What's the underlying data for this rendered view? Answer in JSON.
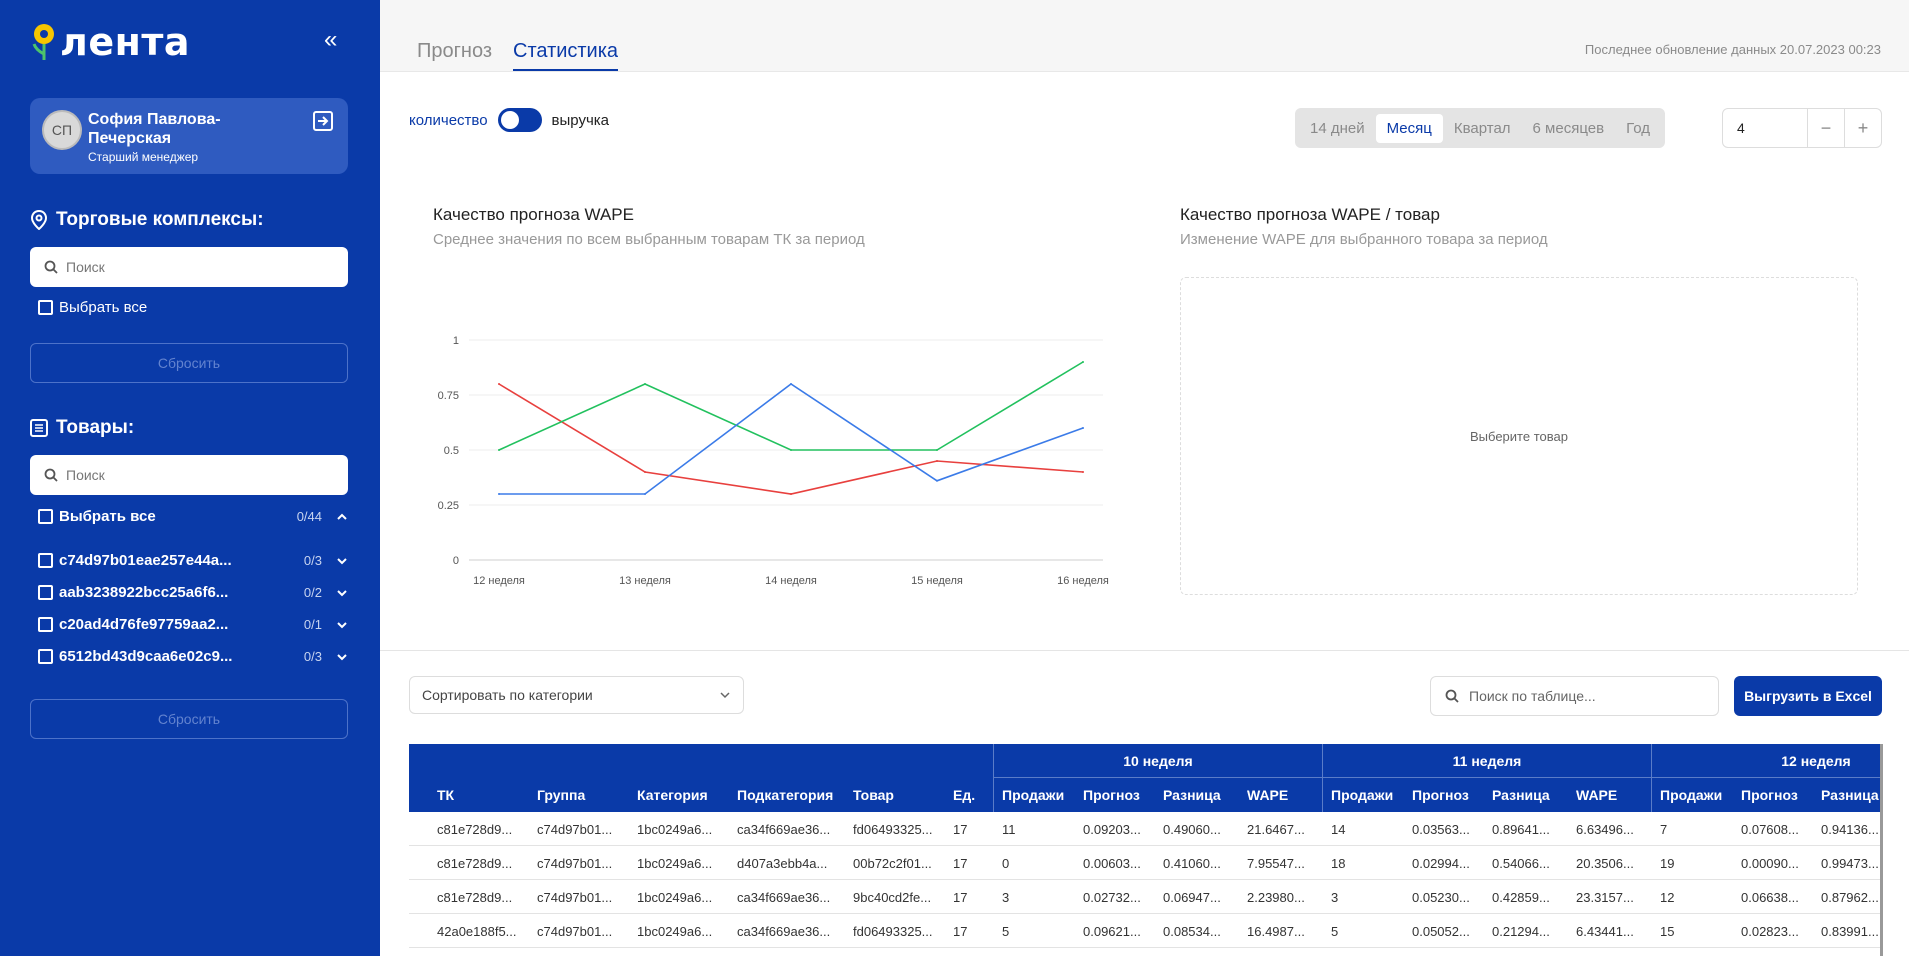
{
  "brand": {
    "logo_text": "лента",
    "primary_color": "#0a3aa8"
  },
  "user": {
    "initials": "СП",
    "name": "София Павлова-Печерская",
    "role": "Старший менеджер"
  },
  "sidebar": {
    "stores_title": "Торговые комплексы:",
    "stores_search_placeholder": "Поиск",
    "stores_select_all": "Выбрать все",
    "stores_reset": "Сбросить",
    "products_title": "Товары:",
    "products_search_placeholder": "Поиск",
    "products_select_all": "Выбрать все",
    "products_select_all_count": "0/44",
    "product_groups": [
      {
        "label": "c74d97b01eae257e44a...",
        "count": "0/3"
      },
      {
        "label": "aab3238922bcc25a6f6...",
        "count": "0/2"
      },
      {
        "label": "c20ad4d76fe97759aa2...",
        "count": "0/1"
      },
      {
        "label": "6512bd43d9caa6e02c9...",
        "count": "0/3"
      }
    ],
    "products_reset": "Сбросить"
  },
  "tabs": {
    "forecast": "Прогноз",
    "stats": "Статистика",
    "active": "Статистика"
  },
  "last_update": "Последнее обновление данных 20.07.2023 00:23",
  "toggle": {
    "left_label": "количество",
    "right_label": "выручка"
  },
  "periods": [
    "14 дней",
    "Месяц",
    "Квартал",
    "6 месяцев",
    "Год"
  ],
  "active_period": "Месяц",
  "stepper": {
    "value": "4",
    "minus": "−",
    "plus": "+"
  },
  "chart1": {
    "title": "Качество прогноза WAPE",
    "subtitle": "Среднее значения по всем выбранным товарам ТК за период"
  },
  "chart2": {
    "title": "Качество прогноза WAPE / товар",
    "subtitle": "Изменение WAPE для выбранного товара за период",
    "placeholder": "Выберите товар"
  },
  "chart_data": {
    "type": "line",
    "categories": [
      "12 неделя",
      "13 неделя",
      "14 неделя",
      "15 неделя",
      "16 неделя"
    ],
    "ylim": [
      0,
      1
    ],
    "yticks": [
      "0",
      "0.25",
      "0.5",
      "0.75",
      "1"
    ],
    "grid": true,
    "series": [
      {
        "color": "#e8403e",
        "values": [
          0.8,
          0.4,
          0.3,
          0.45,
          0.4
        ]
      },
      {
        "color": "#22c15e",
        "values": [
          0.5,
          0.8,
          0.5,
          0.5,
          0.9
        ]
      },
      {
        "color": "#3b7be8",
        "values": [
          0.3,
          0.3,
          0.8,
          0.36,
          0.6
        ]
      }
    ]
  },
  "table_controls": {
    "sort_label": "Сортировать по категории",
    "search_placeholder": "Поиск по таблице...",
    "export_label": "Выгрузить в Excel"
  },
  "table": {
    "fixed_columns": [
      "ТК",
      "Группа",
      "Категория",
      "Подкатегория",
      "Товар",
      "Ед."
    ],
    "weeks": [
      "10 неделя",
      "11 неделя",
      "12 неделя"
    ],
    "week_columns": [
      "Продажи",
      "Прогноз",
      "Разница",
      "WAPE"
    ],
    "rows": [
      [
        "c81e728d9...",
        "c74d97b01...",
        "1bc0249a6...",
        "ca34f669ae36...",
        "fd06493325...",
        "17",
        "11",
        "0.09203...",
        "0.49060...",
        "21.6467...",
        "14",
        "0.03563...",
        "0.89641...",
        "6.63496...",
        "7",
        "0.07608...",
        "0.94136..."
      ],
      [
        "c81e728d9...",
        "c74d97b01...",
        "1bc0249a6...",
        "d407a3ebb4a...",
        "00b72c2f01...",
        "17",
        "0",
        "0.00603...",
        "0.41060...",
        "7.95547...",
        "18",
        "0.02994...",
        "0.54066...",
        "20.3506...",
        "19",
        "0.00090...",
        "0.99473..."
      ],
      [
        "c81e728d9...",
        "c74d97b01...",
        "1bc0249a6...",
        "ca34f669ae36...",
        "9bc40cd2fe...",
        "17",
        "3",
        "0.02732...",
        "0.06947...",
        "2.23980...",
        "3",
        "0.05230...",
        "0.42859...",
        "23.3157...",
        "12",
        "0.06638...",
        "0.87962..."
      ],
      [
        "42a0e188f5...",
        "c74d97b01...",
        "1bc0249a6...",
        "ca34f669ae36...",
        "fd06493325...",
        "17",
        "5",
        "0.09621...",
        "0.08534...",
        "16.4987...",
        "5",
        "0.05052...",
        "0.21294...",
        "6.43441...",
        "15",
        "0.02823...",
        "0.83991..."
      ]
    ]
  }
}
